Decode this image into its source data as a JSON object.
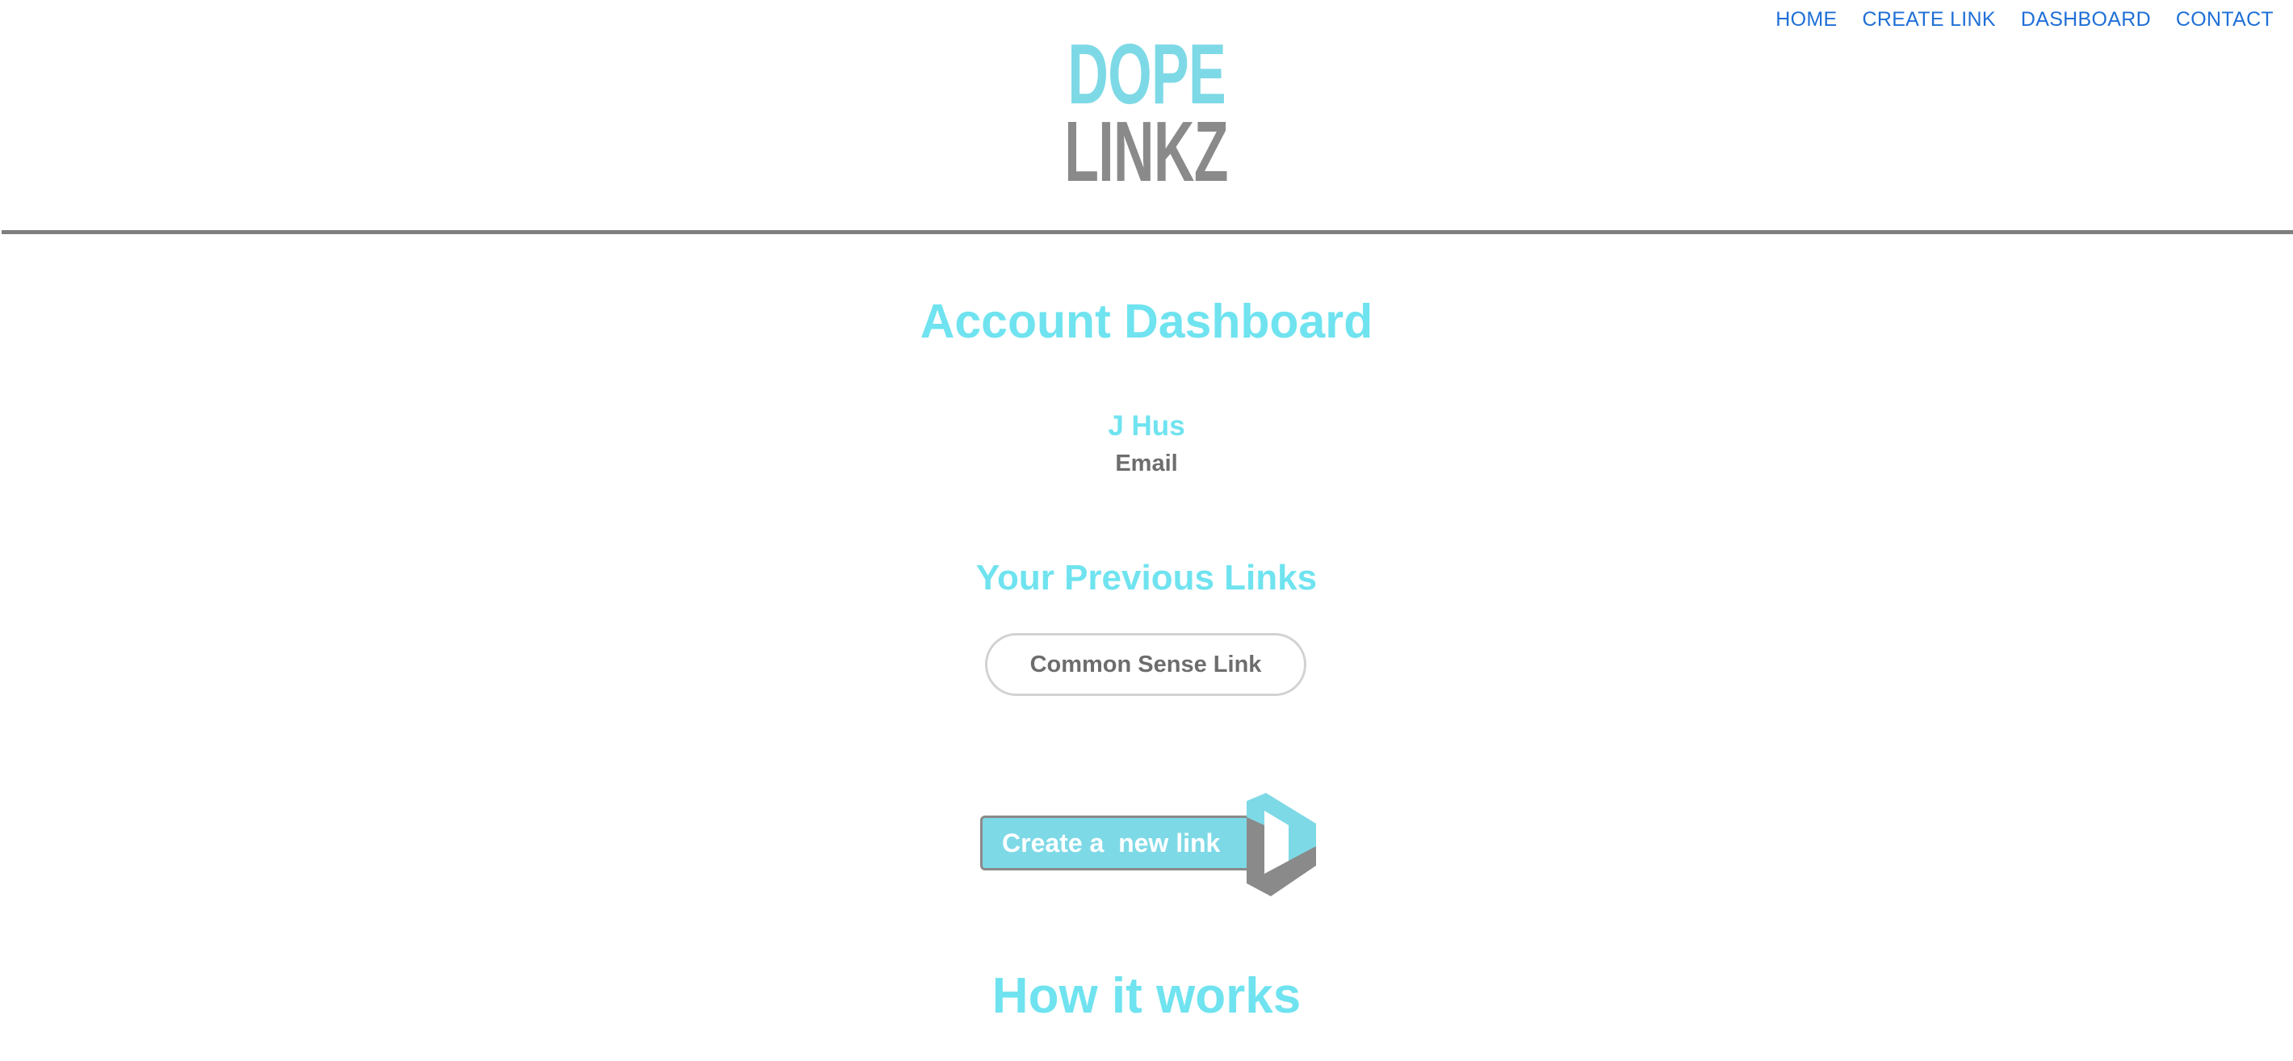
{
  "nav": {
    "items": [
      {
        "label": "HOME"
      },
      {
        "label": "CREATE LINK"
      },
      {
        "label": "DASHBOARD"
      },
      {
        "label": "CONTACT"
      }
    ]
  },
  "logo": {
    "line1": "DOPE",
    "line2": "LINKZ"
  },
  "dashboard": {
    "title": "Account Dashboard",
    "user_name": "J Hus",
    "user_email": "Email"
  },
  "previous_links": {
    "title": "Your Previous Links",
    "items": [
      {
        "label": "Common Sense Link"
      }
    ]
  },
  "create_button": {
    "label": "Create a  new link",
    "icon": "dope-linkz-d-icon"
  },
  "how_it_works": {
    "title": "How it works"
  },
  "colors": {
    "accent_cyan": "#6fe3ef",
    "logo_cyan": "#7ed9e6",
    "gray": "#8a8a8a",
    "nav_blue": "#1f6fd6"
  }
}
